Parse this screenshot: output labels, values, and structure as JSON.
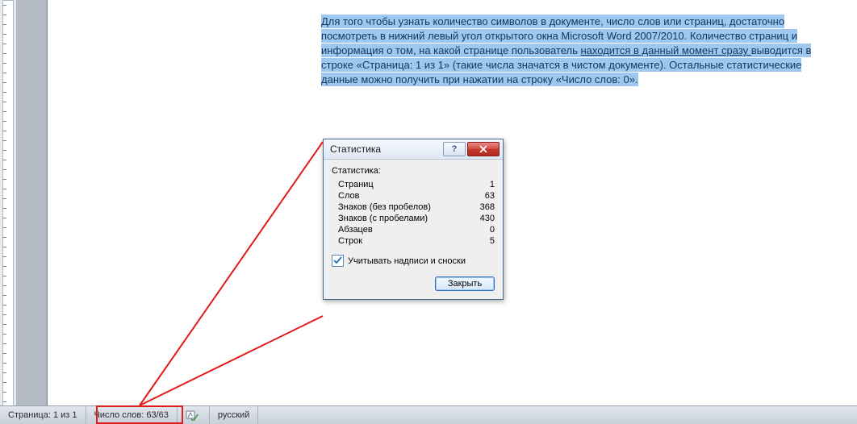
{
  "document": {
    "paragraph_parts": {
      "p1": "Для того чтобы узнать количество символов в документе, число слов или страниц, достаточно",
      "p2": "посмотреть в нижний левый угол открытого окна Microsoft Word 2007/2010. Количество страниц и",
      "p3a": "информация о том, на какой странице пользователь ",
      "p3b": "находится в данный момент сразу ",
      "p3c": "выводится в",
      "p4": "строке «Страница: 1 из 1» (такие числа значатся в чистом документе). Остальные статистические",
      "p5": "данные можно получить при нажатии на строку «Число слов: 0»."
    }
  },
  "dialog": {
    "title": "Статистика",
    "section_label": "Статистика:",
    "rows": [
      {
        "k": "Страниц",
        "v": "1"
      },
      {
        "k": "Слов",
        "v": "63"
      },
      {
        "k": "Знаков (без пробелов)",
        "v": "368"
      },
      {
        "k": "Знаков (с пробелами)",
        "v": "430"
      },
      {
        "k": "Абзацев",
        "v": "0"
      },
      {
        "k": "Строк",
        "v": "5"
      }
    ],
    "checkbox_label": "Учитывать надписи и сноски",
    "checkbox_checked": true,
    "close_button": "Закрыть"
  },
  "statusbar": {
    "page": "Страница: 1 из 1",
    "word_count": "Число слов: 63/63",
    "language": "русский"
  },
  "icons": {
    "help": "?",
    "close": "close-icon",
    "check": "checkmark-icon",
    "spell": "spellcheck-icon"
  }
}
